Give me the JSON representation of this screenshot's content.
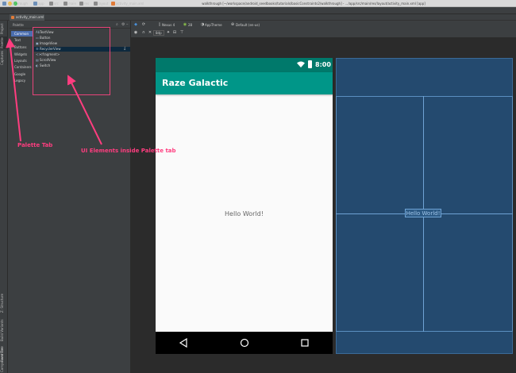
{
  "window": {
    "title": "walkthrough [~/workspace/android_seedbooks/tutorials/basicConstraints2/walkthrough] - .../app/src/main/res/layout/activity_main.xml [app]"
  },
  "breadcrumb": [
    "walkthrough",
    "app",
    "src",
    "main",
    "res",
    "layout",
    "activity_main.xml"
  ],
  "editor_tab": "activity_main.xml",
  "left_strip": {
    "top_items": [
      "Project",
      "Palette",
      "Captures"
    ],
    "bottom_items": [
      "Z: Structure",
      "Build Variants",
      "Favorites",
      "Component Tree"
    ]
  },
  "palette": {
    "title": "Palette",
    "categories": [
      "Common",
      "Text",
      "Buttons",
      "Widgets",
      "Layouts",
      "Containers",
      "Google",
      "Legacy"
    ],
    "selected_category": "Common",
    "items": [
      {
        "label": "TextView",
        "icon": "Ab"
      },
      {
        "label": "Button",
        "icon": "▭"
      },
      {
        "label": "ImageView",
        "icon": "▣"
      },
      {
        "label": "RecyclerView",
        "icon": "☰"
      },
      {
        "label": "<fragment>",
        "icon": "<>"
      },
      {
        "label": "ScrollView",
        "icon": "▤"
      },
      {
        "label": "Switch",
        "icon": "◐"
      }
    ],
    "selected_item": "RecyclerView"
  },
  "toolbar": {
    "device": "Nexus 4",
    "api": "28",
    "theme": "AppTheme",
    "locale": "Default (en-us)",
    "margin": "8dp"
  },
  "phone": {
    "status_time": "8:00",
    "app_title": "Raze Galactic",
    "hello_text": "Hello World!"
  },
  "blueprint": {
    "hello_text": "Hello World!"
  },
  "annotations": {
    "palette_tab": "Palette Tab",
    "ui_elements": "UI Elements inside Palette tab"
  },
  "colors": {
    "primary_dark": "#00796b",
    "primary": "#009688",
    "annotation": "#ff3d7f",
    "blueprint": "#244a6f"
  }
}
